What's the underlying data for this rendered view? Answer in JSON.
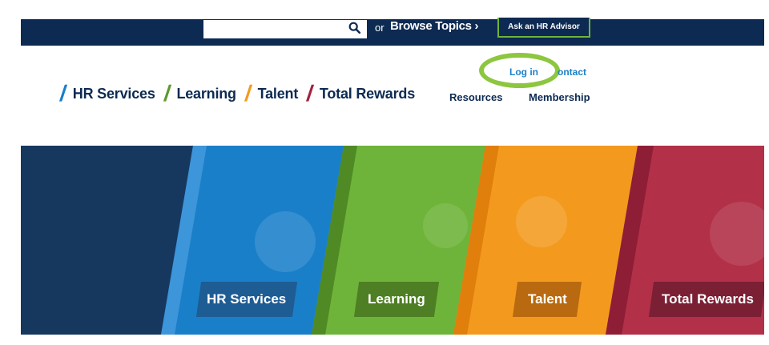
{
  "topbar": {
    "search_placeholder": "",
    "search_icon": "search-icon",
    "or_text": "or",
    "browse_label": "Browse Topics ›",
    "advisor_label": "Ask an HR Advisor"
  },
  "nav": {
    "items": [
      {
        "label": "HR Services",
        "color": "#1a7fc9"
      },
      {
        "label": "Learning",
        "color": "#5b9a2c"
      },
      {
        "label": "Talent",
        "color": "#f39a1e"
      },
      {
        "label": "Total Rewards",
        "color": "#a3223f"
      }
    ]
  },
  "utility": {
    "login": "Log in",
    "contact": "ontact",
    "resources": "Resources",
    "membership": "Membership"
  },
  "hero": {
    "panels": [
      {
        "label": "HR Services",
        "color": "#1a7fc9"
      },
      {
        "label": "Learning",
        "color": "#6fb43a"
      },
      {
        "label": "Talent",
        "color": "#f39a1e"
      },
      {
        "label": "Total Rewards",
        "color": "#b23048"
      }
    ]
  },
  "colors": {
    "navy": "#0d2a52",
    "highlight": "#8dc63f"
  }
}
